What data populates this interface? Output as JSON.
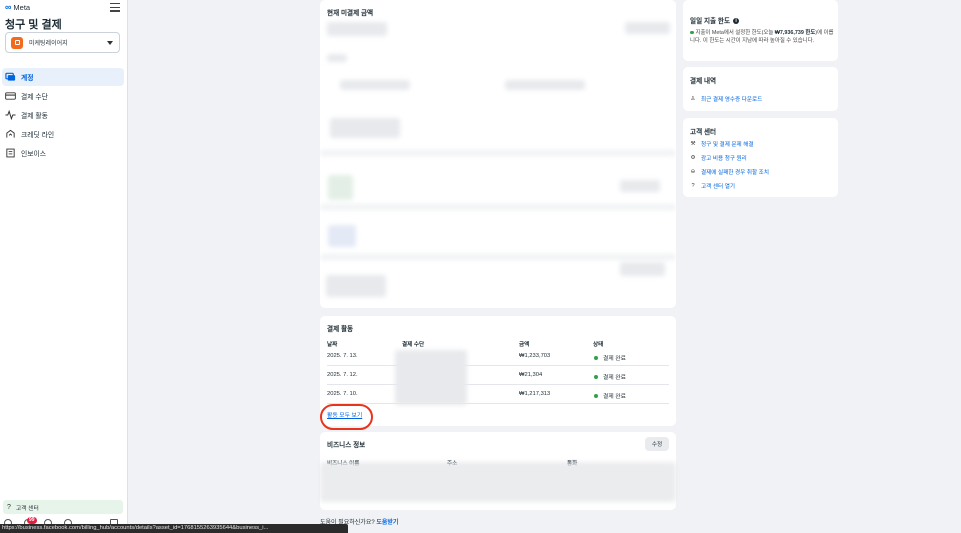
{
  "sidebar": {
    "brand": "Meta",
    "title": "청구 및 결제",
    "account_name": "미케팅레이어지",
    "nav": [
      {
        "label": "계정",
        "icon": "account-icon",
        "active": true
      },
      {
        "label": "결제 수단",
        "icon": "credit-card-icon",
        "active": false
      },
      {
        "label": "결제 활동",
        "icon": "activity-icon",
        "active": false
      },
      {
        "label": "크레딧 라인",
        "icon": "credit-line-icon",
        "active": false
      },
      {
        "label": "인보이스",
        "icon": "invoice-icon",
        "active": false
      }
    ],
    "help_center": "고객 센터",
    "notification_count": "99"
  },
  "status_bar_url": "https://business.facebook.com/billing_hub/accounts/details?asset_id=1768155263935644&business_i...",
  "balance_card": {
    "title": "현재 미결제 금액"
  },
  "payment_activity": {
    "title": "결제 활동",
    "columns": [
      "날짜",
      "결제 수단",
      "금액",
      "상태"
    ],
    "rows": [
      {
        "date": "2025. 7. 13.",
        "amount": "₩1,233,703",
        "status": "결제 완료"
      },
      {
        "date": "2025. 7. 12.",
        "amount": "₩21,304",
        "status": "결제 완료"
      },
      {
        "date": "2025. 7. 10.",
        "amount": "₩1,217,313",
        "status": "결제 완료"
      }
    ],
    "view_all": "활동 모두 보기"
  },
  "business_info": {
    "title": "비즈니스 정보",
    "edit_label": "수정",
    "columns": [
      "비즈니스 이름",
      "주소",
      "통화"
    ]
  },
  "footer": {
    "question": "도움이 필요하신가요?",
    "link": "도움받기"
  },
  "daily_limit": {
    "title": "일일 지출 한도",
    "text_prefix": "지출이 Meta에서 설정한 한도(오늘 ",
    "amount": "₩7,936,739 한도",
    "text_suffix": ")에 이릅니다. 이 한도는 시간이 지남에 따라 높아질 수 있습니다."
  },
  "billing_history": {
    "title": "결제 내역",
    "link": "최근 결제 영수증 다운로드"
  },
  "support": {
    "title": "고객 센터",
    "links": [
      {
        "label": "청구 및 결제 문제 해결",
        "icon": "wrench-icon"
      },
      {
        "label": "광고 비용 청구 원리",
        "icon": "gear-icon"
      },
      {
        "label": "결제에 실패한 경우 취할 조치",
        "icon": "minus-circle-icon"
      },
      {
        "label": "고객 센터 열기",
        "icon": "question-icon"
      }
    ]
  },
  "colors": {
    "accent": "#0064e0",
    "success": "#31a24c",
    "highlight": "#e8341c"
  }
}
